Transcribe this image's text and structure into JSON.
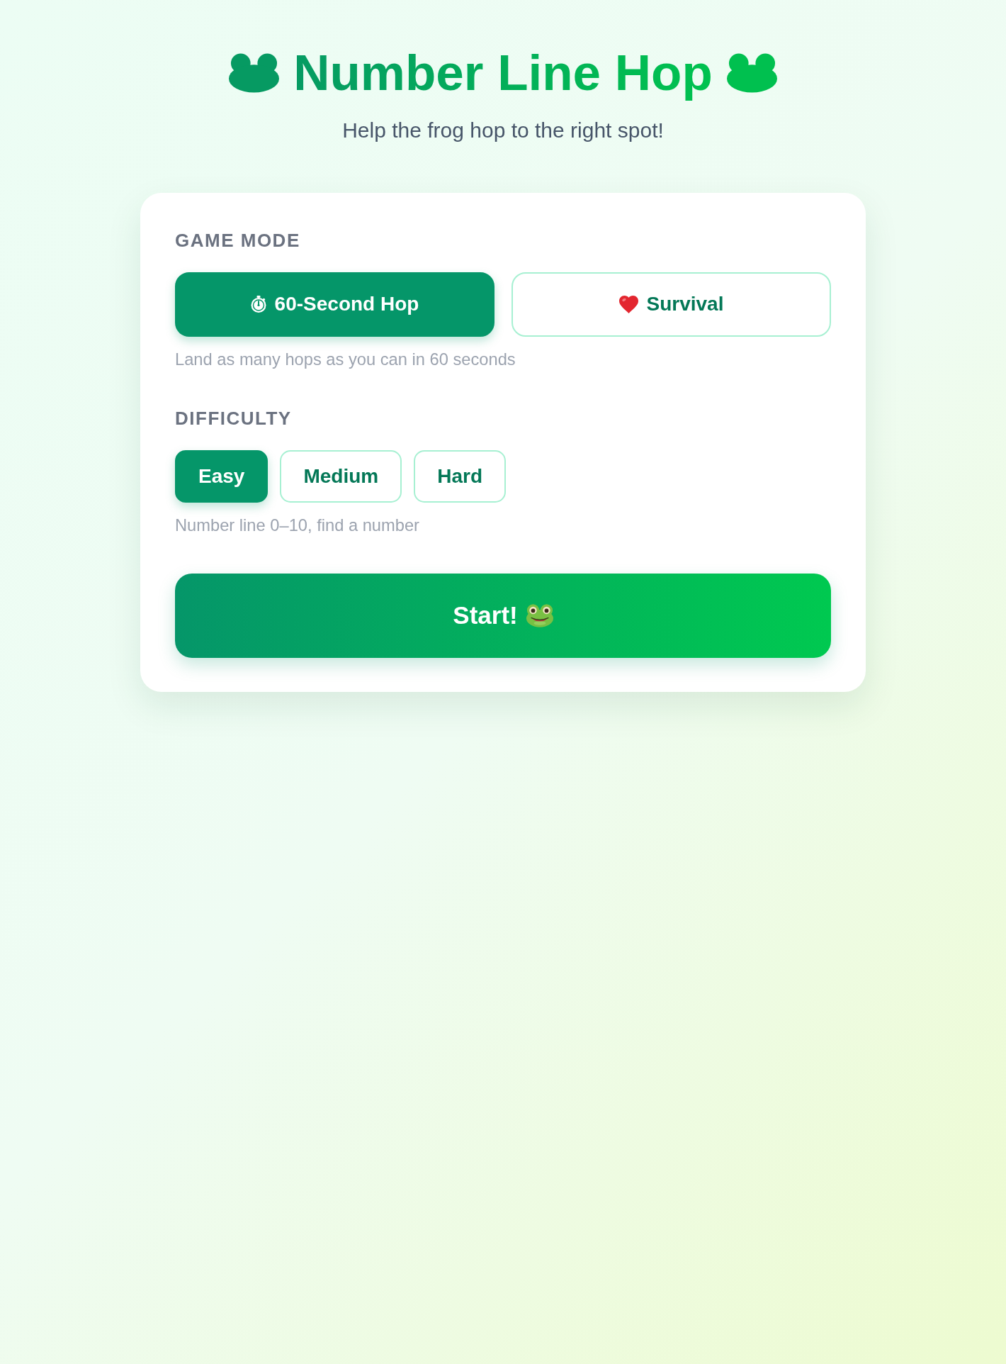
{
  "header": {
    "title": "Number Line Hop",
    "subtitle": "Help the frog hop to the right spot!"
  },
  "sections": [
    {
      "kind": "split",
      "label": "GAME MODE",
      "options": [
        {
          "label": "60-Second Hop",
          "selected": true
        },
        {
          "label": "Survival",
          "selected": false
        }
      ],
      "description": "Land as many hops as you can in 60 seconds"
    },
    {
      "kind": "inline",
      "label": "DIFFICULTY",
      "options": [
        {
          "label": "Easy",
          "selected": true
        },
        {
          "label": "Medium",
          "selected": false
        },
        {
          "label": "Hard",
          "selected": false
        }
      ],
      "description": "Number line 0–10, find a number"
    }
  ],
  "start_button": {
    "label": "Start!"
  }
}
